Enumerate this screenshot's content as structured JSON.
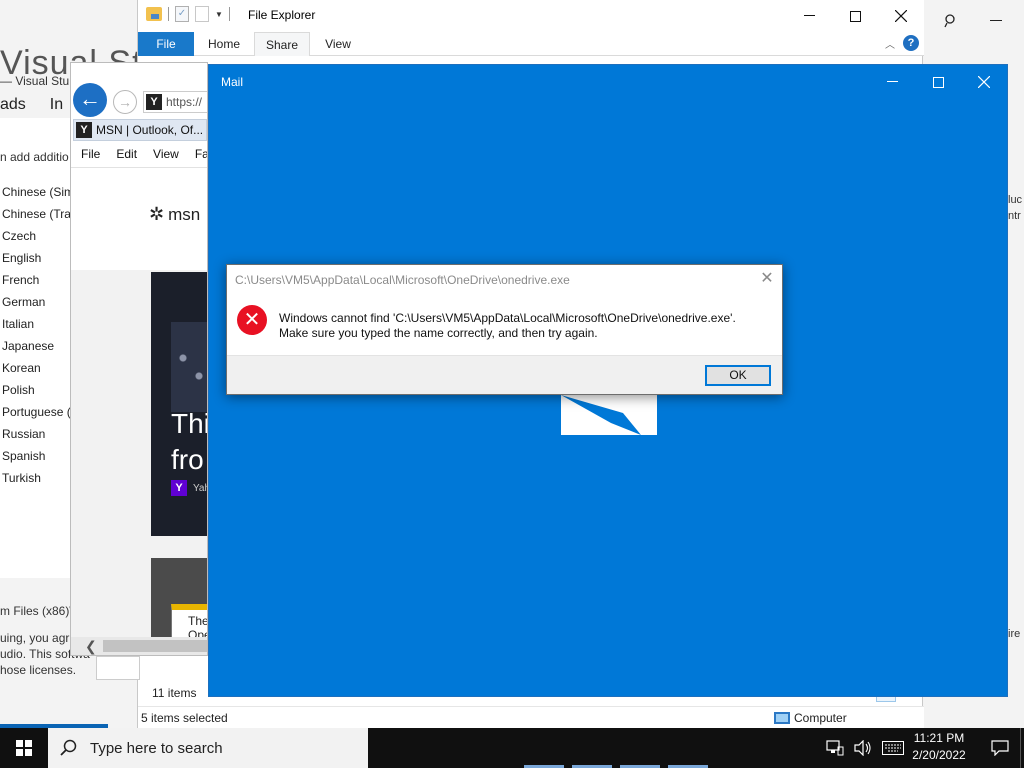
{
  "vs_installer": {
    "big_title": "Visual St",
    "subtitle": "— Visual Stu",
    "tabs": [
      "ads",
      "In"
    ],
    "add_text": "n add additio",
    "languages": [
      "Chinese (Sim",
      "Chinese (Trad",
      "Czech",
      "English",
      "French",
      "German",
      "Italian",
      "Japanese",
      "Korean",
      "Polish",
      "Portuguese (",
      "Russian",
      "Spanish",
      "Turkish"
    ],
    "install_path": "m Files (x86)\\",
    "license_lines": [
      "uing, you agr",
      "udio. This softwa",
      "hose licenses."
    ],
    "right_text": [
      "luc",
      "ntr"
    ],
    "right_text2": "ire"
  },
  "file_explorer": {
    "title": "File Explorer",
    "ribbon_tabs": [
      "File",
      "Home",
      "Share",
      "View"
    ],
    "items_count": "11 items",
    "selected": "5 items selected",
    "location": "Computer",
    "help": "?"
  },
  "ie": {
    "url": "https://",
    "tab_label": "MSN | Outlook, Of...",
    "menu": [
      "File",
      "Edit",
      "View",
      "Fav"
    ],
    "msn_logo": "msn",
    "headline": [
      "Thi",
      "fro"
    ],
    "source": "Yah",
    "note_lines": [
      "The",
      "Ope"
    ]
  },
  "mail": {
    "title": "Mail"
  },
  "dialog": {
    "title": "C:\\Users\\VM5\\AppData\\Local\\Microsoft\\OneDrive\\onedrive.exe",
    "message_line1": "Windows cannot find 'C:\\Users\\VM5\\AppData\\Local\\Microsoft\\OneDrive\\onedrive.exe'.",
    "message_line2": "Make sure you typed the name correctly, and then try again.",
    "ok_label": "OK"
  },
  "taskbar": {
    "search_placeholder": "Type here to search",
    "time": "11:21 PM",
    "date": "2/20/2022"
  },
  "icons": {
    "start": "windows-logo-icon",
    "search": "magnifier-icon",
    "error": "error-x-icon",
    "network": "network-icon",
    "volume": "volume-icon",
    "keyboard": "keyboard-icon",
    "notification": "notification-icon"
  },
  "colors": {
    "mail_blue": "#0078d7",
    "error_red": "#e81123",
    "ribbon_file": "#1979ca",
    "taskbar": "#101010"
  }
}
